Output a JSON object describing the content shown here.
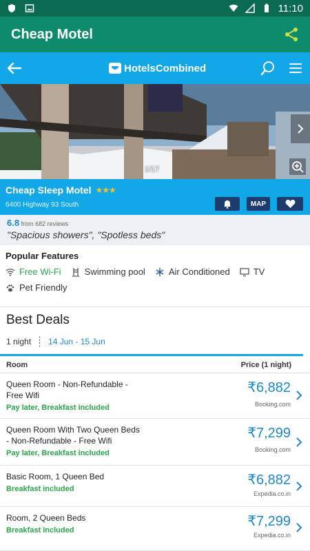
{
  "status_bar": {
    "time": "11:10"
  },
  "app_bar": {
    "title": "Cheap Motel"
  },
  "web_header": {
    "logo_text": "HotelsCombined"
  },
  "gallery": {
    "counter": "1/17"
  },
  "hotel": {
    "name": "Cheap Sleep Motel",
    "address": "6400 Highway 93 South",
    "stars": "★★★",
    "map_label": "MAP"
  },
  "rating": {
    "score": "6.8",
    "reviews": "from 682 reviews",
    "quote": "\"Spacious showers\", \"Spotless beds\""
  },
  "features": {
    "title": "Popular Features",
    "items": [
      "Free Wi-Fi",
      "Swimming pool",
      "Air Conditioned",
      "TV",
      "Pet Friendly"
    ]
  },
  "deals": {
    "title": "Best Deals",
    "nights": "1 night",
    "dates": "14 Jun - 15 Jun",
    "col_room": "Room",
    "col_price": "Price (1 night)",
    "rows": [
      {
        "room": "Queen Room - Non-Refundable - Free Wifi",
        "note": "Pay later, Breakfast included",
        "price": "₹6,882",
        "source": "Booking.com"
      },
      {
        "room": "Queen Room With Two Queen Beds - Non-Refundable - Free Wifi",
        "note": "Pay later, Breakfast included",
        "price": "₹7,299",
        "source": "Booking.com"
      },
      {
        "room": "Basic Room, 1 Queen Bed",
        "note": "Breakfast included",
        "price": "₹6,882",
        "source": "Expedia.co.in"
      },
      {
        "room": "Room, 2 Queen Beds",
        "note": "Breakfast included",
        "price": "₹7,299",
        "source": "Expedia.co.in"
      }
    ]
  },
  "colors": {
    "status_bar": "#0b6b52",
    "app_bar": "#0e8a6c",
    "brand_blue": "#12a7e6",
    "price_blue": "#1e88c8",
    "green_text": "#2aa54a",
    "dark_button": "#1d3c6e"
  }
}
